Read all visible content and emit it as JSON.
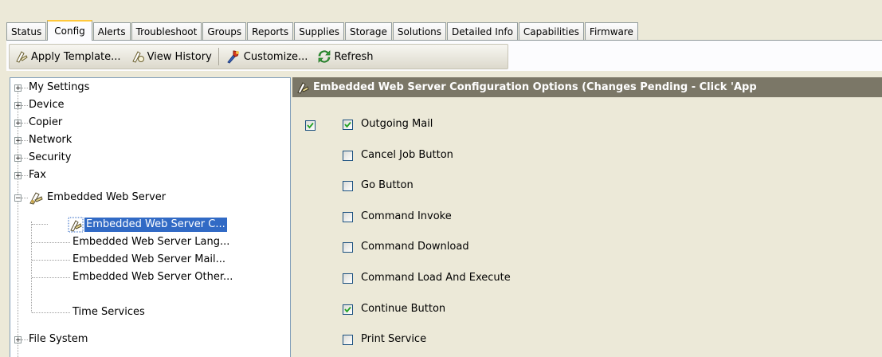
{
  "tabs": [
    {
      "label": "Status",
      "active": false
    },
    {
      "label": "Config",
      "active": true
    },
    {
      "label": "Alerts",
      "active": false
    },
    {
      "label": "Troubleshoot",
      "active": false
    },
    {
      "label": "Groups",
      "active": false
    },
    {
      "label": "Reports",
      "active": false
    },
    {
      "label": "Supplies",
      "active": false
    },
    {
      "label": "Storage",
      "active": false
    },
    {
      "label": "Solutions",
      "active": false
    },
    {
      "label": "Detailed Info",
      "active": false
    },
    {
      "label": "Capabilities",
      "active": false
    },
    {
      "label": "Firmware",
      "active": false
    }
  ],
  "toolbar": {
    "apply_template": "Apply Template...",
    "view_history": "View History",
    "customize": "Customize...",
    "refresh": "Refresh"
  },
  "tree": {
    "my_settings": "My Settings",
    "device": "Device",
    "copier": "Copier",
    "network": "Network",
    "security": "Security",
    "fax": "Fax",
    "ews": "Embedded Web Server",
    "ews_config": "Embedded Web Server C...",
    "ews_lang": "Embedded Web Server Lang...",
    "ews_mail": "Embedded Web Server Mail...",
    "ews_other": "Embedded Web Server Other...",
    "time_services": "Time Services",
    "file_system": "File System"
  },
  "panel": {
    "header": "Embedded Web Server Configuration Options (Changes Pending - Click 'App",
    "master_checked": true,
    "options": [
      {
        "label": "Outgoing Mail",
        "checked": true
      },
      {
        "label": "Cancel Job Button",
        "checked": false
      },
      {
        "label": "Go Button",
        "checked": false
      },
      {
        "label": "Command Invoke",
        "checked": false
      },
      {
        "label": "Command Download",
        "checked": false
      },
      {
        "label": "Command Load And Execute",
        "checked": false
      },
      {
        "label": "Continue Button",
        "checked": true
      },
      {
        "label": "Print Service",
        "checked": false
      }
    ]
  },
  "colors": {
    "accent_tab": "#ffc83c",
    "selection": "#316ac5",
    "header_bg": "#7b7767",
    "check": "#21a121"
  }
}
